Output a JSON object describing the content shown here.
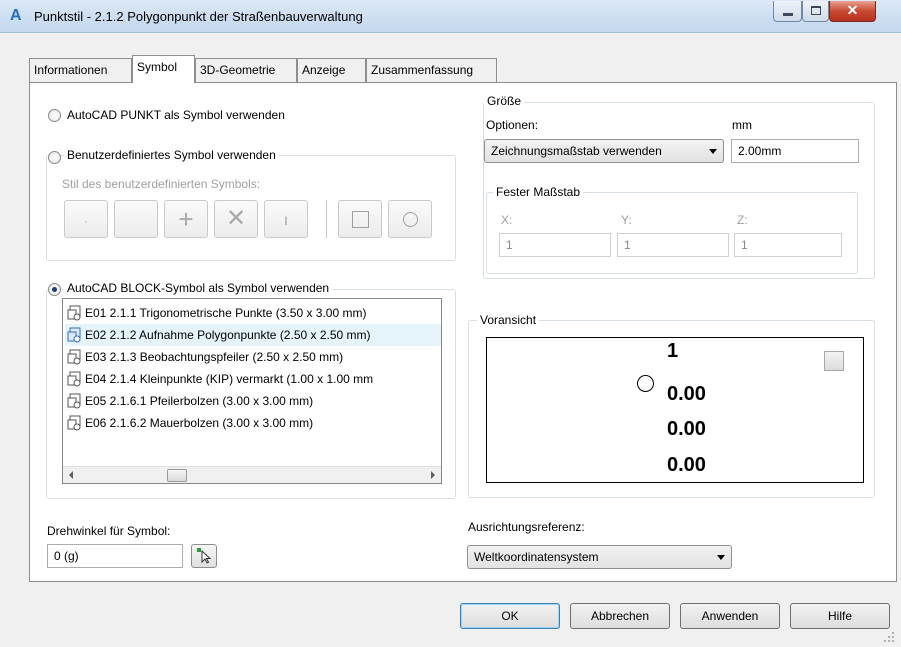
{
  "window": {
    "title": "Punktstil - 2.1.2 Polygonpunkt der Straßenbauverwaltung",
    "app_icon": "A",
    "close_glyph": "✕"
  },
  "tabs": [
    {
      "label": "Informationen"
    },
    {
      "label": "Symbol"
    },
    {
      "label": "3D-Geometrie"
    },
    {
      "label": "Anzeige"
    },
    {
      "label": "Zusammenfassung"
    }
  ],
  "symbol": {
    "radio_autocad_point": "AutoCAD PUNKT als Symbol verwenden",
    "radio_custom": "Benutzerdefiniertes Symbol verwenden",
    "custom_style_label": "Stil des benutzerdefinierten Symbols:",
    "radio_block": "AutoCAD BLOCK-Symbol als Symbol verwenden",
    "block_items": [
      {
        "label": "E01  2.1.1 Trigonometrische Punkte (3.50 x 3.00 mm)"
      },
      {
        "label": "E02  2.1.2 Aufnahme Polygonpunkte (2.50 x 2.50 mm)"
      },
      {
        "label": "E03  2.1.3 Beobachtungspfeiler (2.50 x 2.50 mm)"
      },
      {
        "label": "E04  2.1.4 Kleinpunkte (KIP) vermarkt (1.00 x 1.00 mm"
      },
      {
        "label": "E05  2.1.6.1 Pfeilerbolzen (3.00 x 3.00 mm)"
      },
      {
        "label": "E06  2.1.6.2 Mauerbolzen (3.00 x 3.00 mm)"
      }
    ],
    "rotation_label": "Drehwinkel für Symbol:",
    "rotation_value": "0 (g)"
  },
  "size": {
    "group_title": "Größe",
    "options_label": "Optionen:",
    "unit_label": "mm",
    "option_selected": "Zeichnungsmaßstab verwenden",
    "size_value": "2.00mm",
    "fixed_scale_title": "Fester Maßstab",
    "x_label": "X:",
    "y_label": "Y:",
    "z_label": "Z:",
    "x_value": "1",
    "y_value": "1",
    "z_value": "1"
  },
  "preview": {
    "title": "Voransicht",
    "line1": "1",
    "line2": "0.00",
    "line3": "0.00",
    "line4": "0.00"
  },
  "orientation": {
    "label": "Ausrichtungsreferenz:",
    "selected": "Weltkoordinatensystem"
  },
  "buttons": {
    "ok": "OK",
    "cancel": "Abbrechen",
    "apply": "Anwenden",
    "help": "Hilfe"
  }
}
